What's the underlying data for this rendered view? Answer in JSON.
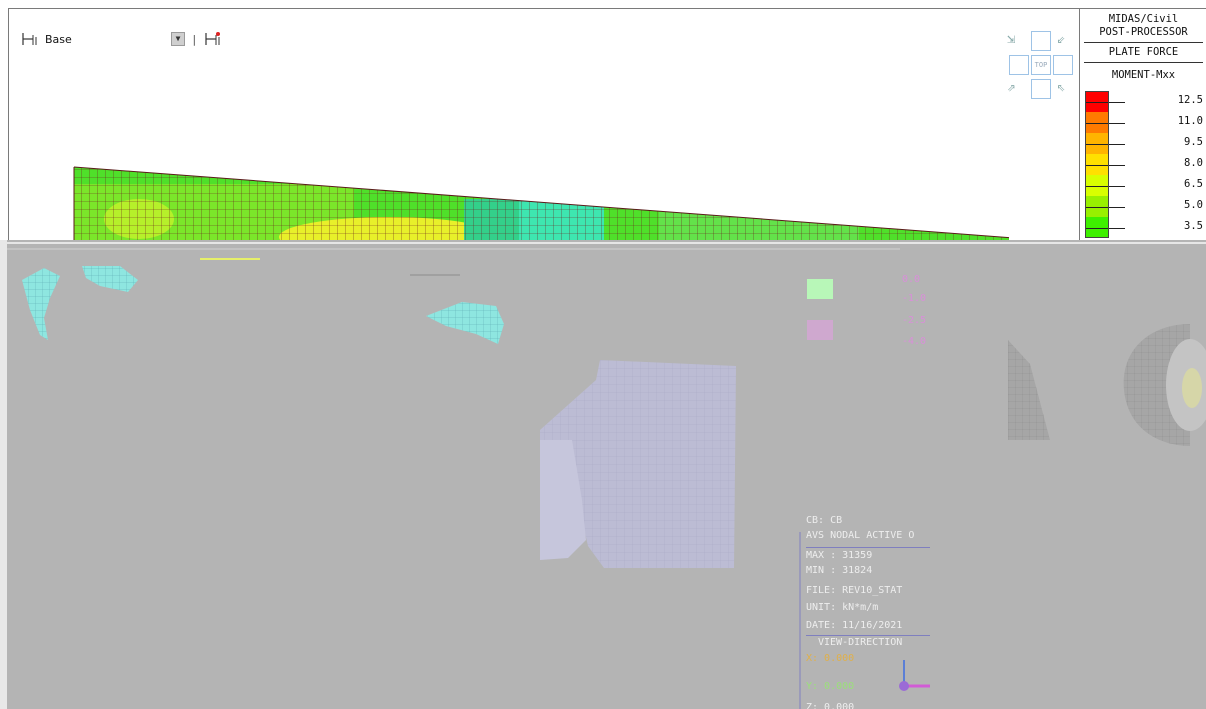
{
  "toolbar": {
    "base_label": "Base"
  },
  "view_cube": {
    "top_label": "TOP"
  },
  "legend": {
    "program": "MIDAS/Civil",
    "module": "POST-PROCESSOR",
    "result_type": "PLATE FORCE",
    "component": "MOMENT-Mxx",
    "levels": [
      {
        "value": "12.5",
        "color": "#ff0000"
      },
      {
        "value": "11.0",
        "color": "#ff7a00"
      },
      {
        "value": "9.5",
        "color": "#ffb400"
      },
      {
        "value": "8.0",
        "color": "#ffe000"
      },
      {
        "value": "6.5",
        "color": "#d8ff00"
      },
      {
        "value": "5.0",
        "color": "#98f000"
      },
      {
        "value": "3.5",
        "color": "#3ef000"
      }
    ]
  },
  "lower_legend": {
    "values": [
      "0.0",
      "-1.0",
      "-2.5",
      "-4.0"
    ],
    "colors": [
      "#b8f7b8",
      "#cfa8cf"
    ]
  },
  "info_block": {
    "lines": [
      "CB: CB",
      "AVS NODAL ACTIVE O",
      "MAX : 31359",
      "MIN : 31824",
      "FILE: REV10_STAT",
      "UNIT: kN*m/m",
      "DATE: 11/16/2021",
      "VIEW-DIRECTION",
      "X: 0.000",
      "Y: 0.000",
      "Z: 0.000"
    ]
  },
  "colors": {
    "mesh_line": "#6b1d1d",
    "mesh_green": "#4fe02a",
    "mesh_cyan": "#3ee6b0",
    "mesh_yellow": "#e8f02a",
    "grey_bg": "#b4b4b4"
  }
}
